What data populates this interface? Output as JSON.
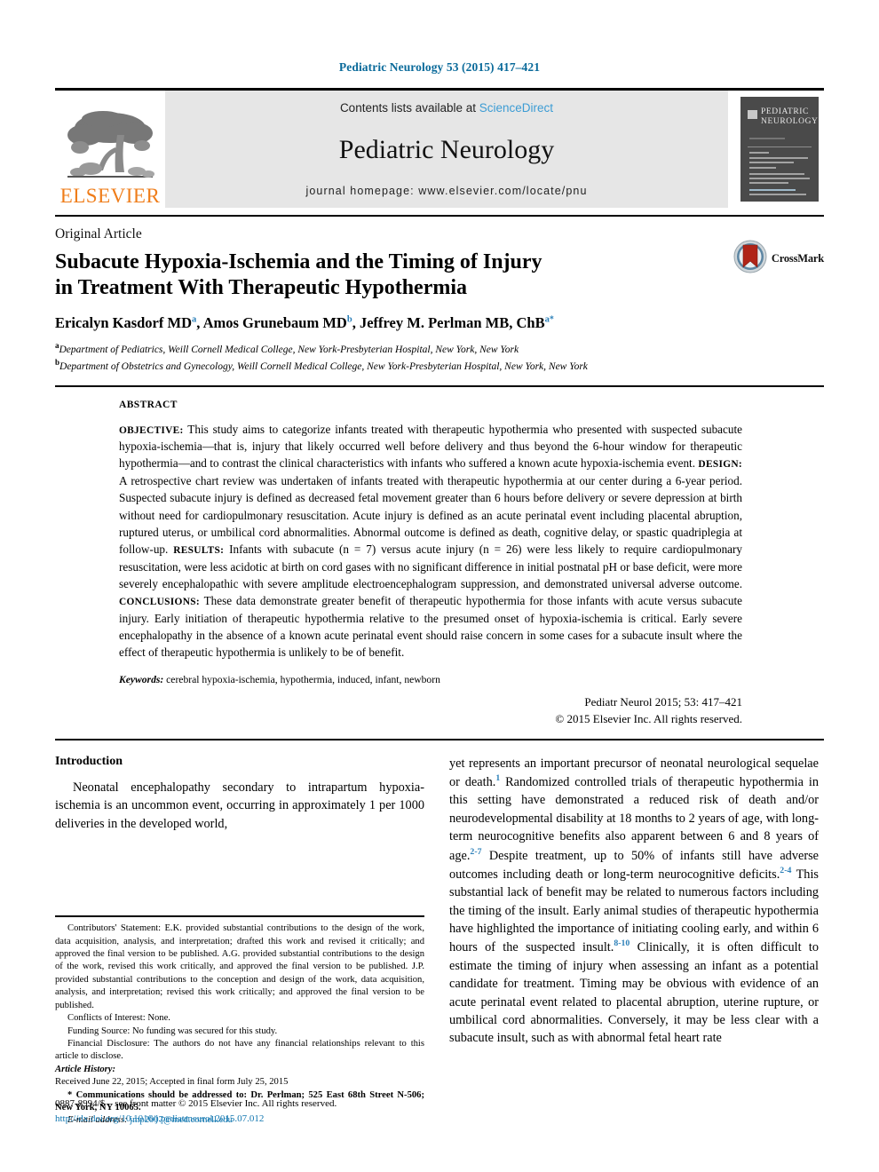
{
  "running_head": "Pediatric Neurology 53 (2015) 417–421",
  "masthead": {
    "publisher_name": "ELSEVIER",
    "contents_prefix": "Contents lists available at ",
    "contents_link": "ScienceDirect",
    "journal_title": "Pediatric Neurology",
    "homepage": "journal homepage: www.elsevier.com/locate/pnu",
    "cover_title_line1": "PEDIATRIC",
    "cover_title_line2": "NEUROLOGY"
  },
  "article": {
    "type": "Original Article",
    "title_line1": "Subacute Hypoxia-Ischemia and the Timing of Injury",
    "title_line2": "in Treatment With Therapeutic Hypothermia",
    "crossmark_label": "CrossMark",
    "authors": [
      {
        "name": "Ericalyn Kasdorf MD",
        "sup": "a",
        "sep": ", "
      },
      {
        "name": "Amos Grunebaum MD",
        "sup": "b",
        "sep": ", "
      },
      {
        "name": "Jeffrey M. Perlman MB, ChB",
        "sup": "a",
        "sep": ""
      }
    ],
    "affiliations": [
      {
        "marker": "a",
        "text": "Department of Pediatrics, Weill Cornell Medical College, New York-Presbyterian Hospital, New York, New York"
      },
      {
        "marker": "b",
        "text": "Department of Obstetrics and Gynecology, Weill Cornell Medical College, New York-Presbyterian Hospital, New York, New York"
      }
    ]
  },
  "abstract": {
    "heading": "ABSTRACT",
    "sections": [
      {
        "label": "OBJECTIVE:",
        "text": " This study aims to categorize infants treated with therapeutic hypothermia who presented with suspected subacute hypoxia-ischemia—that is, injury that likely occurred well before delivery and thus beyond the 6-hour window for therapeutic hypothermia—and to contrast the clinical characteristics with infants who suffered a known acute hypoxia-ischemia event. "
      },
      {
        "label": "DESIGN:",
        "text": " A retrospective chart review was undertaken of infants treated with therapeutic hypothermia at our center during a 6-year period. Suspected subacute injury is defined as decreased fetal movement greater than 6 hours before delivery or severe depression at birth without need for cardiopulmonary resuscitation. Acute injury is defined as an acute perinatal event including placental abruption, ruptured uterus, or umbilical cord abnormalities. Abnormal outcome is defined as death, cognitive delay, or spastic quadriplegia at follow-up. "
      },
      {
        "label": "RESULTS:",
        "text": " Infants with subacute (n = 7) versus acute injury (n = 26) were less likely to require cardiopulmonary resuscitation, were less acidotic at birth on cord gases with no significant difference in initial postnatal pH or base deficit, were more severely encephalopathic with severe amplitude electroencephalogram suppression, and demonstrated universal adverse outcome. "
      },
      {
        "label": "CONCLUSIONS:",
        "text": " These data demonstrate greater benefit of therapeutic hypothermia for those infants with acute versus subacute injury. Early initiation of therapeutic hypothermia relative to the presumed onset of hypoxia-ischemia is critical. Early severe encephalopathy in the absence of a known acute perinatal event should raise concern in some cases for a subacute insult where the effect of therapeutic hypothermia is unlikely to be of benefit."
      }
    ],
    "keywords_label": "Keywords:",
    "keywords": " cerebral hypoxia-ischemia, hypothermia, induced, infant, newborn",
    "citation": "Pediatr Neurol 2015; 53: 417–421",
    "copyright": "© 2015 Elsevier Inc. All rights reserved."
  },
  "body": {
    "intro_heading": "Introduction",
    "left_paragraph": "Neonatal encephalopathy secondary to intrapartum hypoxia-ischemia is an uncommon event, occurring in approximately 1 per 1000 deliveries in the developed world,",
    "right_paragraph_1": "yet represents an important precursor of neonatal neurological sequelae or death.",
    "right_ref_1": "1",
    "right_paragraph_2": " Randomized controlled trials of therapeutic hypothermia in this setting have demonstrated a reduced risk of death and/or neurodevelopmental disability at 18 months to 2 years of age, with long-term neurocognitive benefits also apparent between 6 and 8 years of age.",
    "right_ref_2": "2-7",
    "right_paragraph_3": " Despite treatment, up to 50% of infants still have adverse outcomes including death or long-term neurocognitive deficits.",
    "right_ref_3": "2-4",
    "right_paragraph_4": " This substantial lack of benefit may be related to numerous factors including the timing of the insult. Early animal studies of therapeutic hypothermia have highlighted the importance of initiating cooling early, and within 6 hours of the suspected insult.",
    "right_ref_4": "8-10",
    "right_paragraph_5": " Clinically, it is often difficult to estimate the timing of injury when assessing an infant as a potential candidate for treatment. Timing may be obvious with evidence of an acute perinatal event related to placental abruption, uterine rupture, or umbilical cord abnormalities. Conversely, it may be less clear with a subacute insult, such as with abnormal fetal heart rate"
  },
  "footnotes": {
    "contributors": "Contributors' Statement: E.K. provided substantial contributions to the design of the work, data acquisition, analysis, and interpretation; drafted this work and revised it critically; and approved the final version to be published. A.G. provided substantial contributions to the design of the work, revised this work critically, and approved the final version to be published. J.P. provided substantial contributions to the conception and design of the work, data acquisition, analysis, and interpretation; revised this work critically; and approved the final version to be published.",
    "conflicts": "Conflicts of Interest: None.",
    "funding": "Funding Source: No funding was secured for this study.",
    "disclosure": "Financial Disclosure: The authors do not have any financial relationships relevant to this article to disclose.",
    "history_label": "Article History:",
    "history": "Received June 22, 2015; Accepted in final form July 25, 2015",
    "correspondence": "* Communications should be addressed to: Dr. Perlman; 525 East 68th Street N-506; New York, NY 10065.",
    "email_label": "E-mail address:",
    "email": "jmp2007@med.cornell.edu"
  },
  "imprint": {
    "frontmatter": "0887-8994/$ – see front matter © 2015 Elsevier Inc. All rights reserved.",
    "doi": "http://dx.doi.org/10.1016/j.pediatrneurol.2015.07.012"
  },
  "colors": {
    "running_head": "#0a6a9a",
    "science_direct_link": "#3c9cd4",
    "reference_link": "#2a7fb8",
    "doi_link": "#1277b0",
    "elsevier_orange": "#ef7d1a",
    "masthead_bg": "#e6e6e6",
    "cover_bg": "#4a4a4a",
    "crossmark_red": "#b02418",
    "crossmark_blue": "#4a7fa5"
  }
}
